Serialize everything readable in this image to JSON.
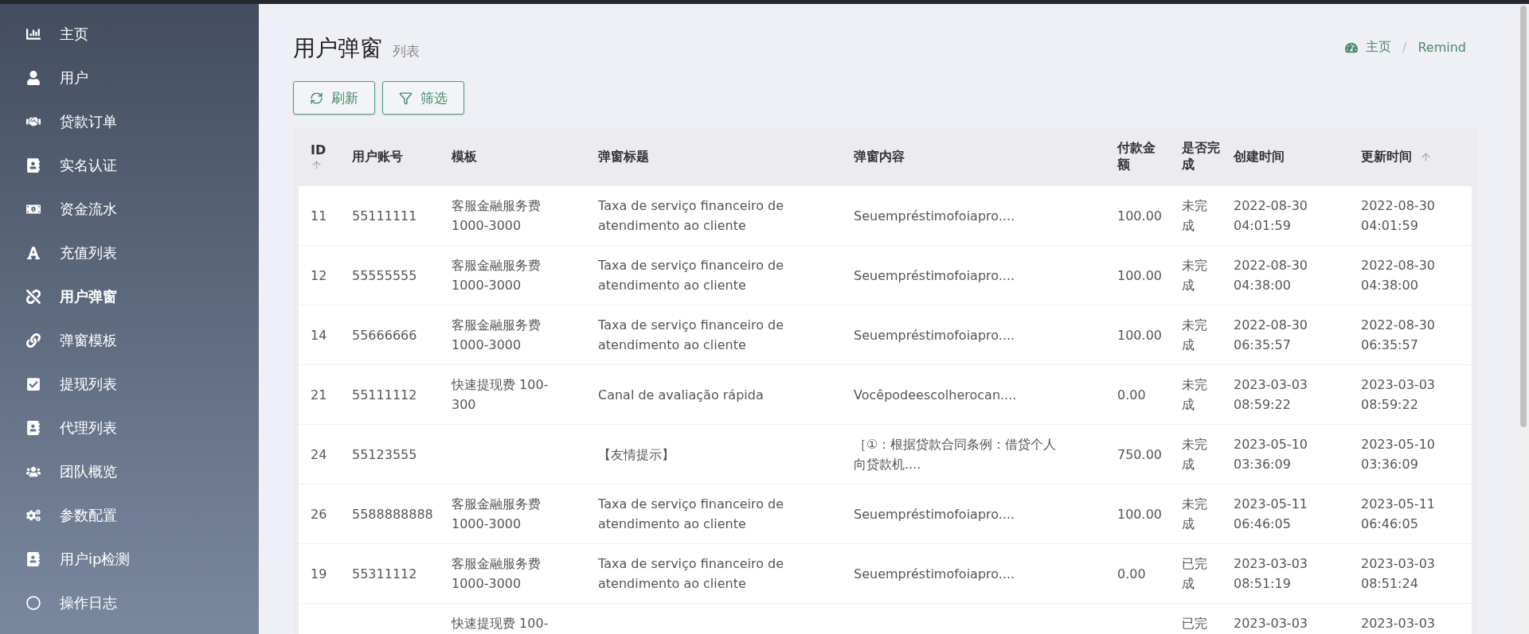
{
  "sidebar": {
    "items": [
      {
        "label": "主页",
        "selected": false
      },
      {
        "label": "用户",
        "selected": false
      },
      {
        "label": "贷款订单",
        "selected": false
      },
      {
        "label": "实名认证",
        "selected": false
      },
      {
        "label": "资金流水",
        "selected": false
      },
      {
        "label": "充值列表",
        "selected": false
      },
      {
        "label": "用户弹窗",
        "selected": true
      },
      {
        "label": "弹窗模板",
        "selected": false
      },
      {
        "label": "提现列表",
        "selected": false
      },
      {
        "label": "代理列表",
        "selected": false
      },
      {
        "label": "团队概览",
        "selected": false
      },
      {
        "label": "参数配置",
        "selected": false
      },
      {
        "label": "用户ip检测",
        "selected": false
      },
      {
        "label": "操作日志",
        "selected": false
      }
    ]
  },
  "header": {
    "title": "用户弹窗",
    "subtitle": "列表",
    "breadcrumb": [
      "主页",
      "Remind"
    ],
    "separator": "/"
  },
  "toolbar": [
    {
      "kind": "refresh",
      "label": "刷新"
    },
    {
      "kind": "filter",
      "label": "筛选"
    }
  ],
  "table": {
    "columns": [
      {
        "label": "ID",
        "sort_arrow": true
      },
      {
        "label": "用户账号",
        "sort_arrow": false
      },
      {
        "label": "模板",
        "sort_arrow": false
      },
      {
        "label": "弹窗标题",
        "sort_arrow": false
      },
      {
        "label": "弹窗内容",
        "sort_arrow": false
      },
      {
        "label": "付款金额",
        "sort_arrow": false
      },
      {
        "label": "是否完成",
        "sort_arrow": false
      },
      {
        "label": "创建时间",
        "sort_arrow": false
      },
      {
        "label": "更新时间",
        "sort_arrow": true
      }
    ],
    "rows": [
      {
        "id": "11",
        "account": "55111111",
        "template": "客服金融服务费 1000-3000",
        "title": "Taxa de serviço financeiro de atendimento ao cliente",
        "content": "Seuempréstimofoiapro....",
        "amount": "100.00",
        "status": "未完成",
        "created": "2022-08-30 04:01:59",
        "updated": "2022-08-30 04:01:59",
        "cut_off": false
      },
      {
        "id": "12",
        "account": "55555555",
        "template": "客服金融服务费 1000-3000",
        "title": "Taxa de serviço financeiro de atendimento ao cliente",
        "content": "Seuempréstimofoiapro....",
        "amount": "100.00",
        "status": "未完成",
        "created": "2022-08-30 04:38:00",
        "updated": "2022-08-30 04:38:00",
        "cut_off": false
      },
      {
        "id": "14",
        "account": "55666666",
        "template": "客服金融服务费 1000-3000",
        "title": "Taxa de serviço financeiro de atendimento ao cliente",
        "content": "Seuempréstimofoiapro....",
        "amount": "100.00",
        "status": "未完成",
        "created": "2022-08-30 06:35:57",
        "updated": "2022-08-30 06:35:57",
        "cut_off": false
      },
      {
        "id": "21",
        "account": "55111112",
        "template": "快速提现费 100-300",
        "title": "Canal de avaliação rápida",
        "content": "Vocêpodeescolherocan....",
        "amount": "0.00",
        "status": "未完成",
        "created": "2023-03-03 08:59:22",
        "updated": "2023-03-03 08:59:22",
        "cut_off": false
      },
      {
        "id": "24",
        "account": "55123555",
        "title": "【友情提示】",
        "content": "［①：根据贷款合同条例：借贷个人向贷款机....",
        "amount": "750.00",
        "status": "未完成",
        "created": "2023-05-10 03:36:09",
        "updated": "2023-05-10 03:36:09",
        "cut_off": false
      },
      {
        "id": "26",
        "account": "5588888888",
        "template": "客服金融服务费 1000-3000",
        "title": "Taxa de serviço financeiro de atendimento ao cliente",
        "content": "Seuempréstimofoiapro....",
        "amount": "100.00",
        "status": "未完成",
        "created": "2023-05-11 06:46:05",
        "updated": "2023-05-11 06:46:05",
        "cut_off": false
      },
      {
        "id": "19",
        "account": "55311112",
        "template": "客服金融服务费 1000-3000",
        "title": "Taxa de serviço financeiro de atendimento ao cliente",
        "content": "Seuempréstimofoiapro....",
        "amount": "0.00",
        "status": "已完成",
        "created": "2023-03-03 08:51:19",
        "updated": "2023-03-03 08:51:24",
        "cut_off": false
      },
      {
        "template": "快速提现费 100-",
        "status": "已完",
        "created": "2023-03-03",
        "updated": "2023-03-03",
        "cut_off": true
      }
    ]
  }
}
